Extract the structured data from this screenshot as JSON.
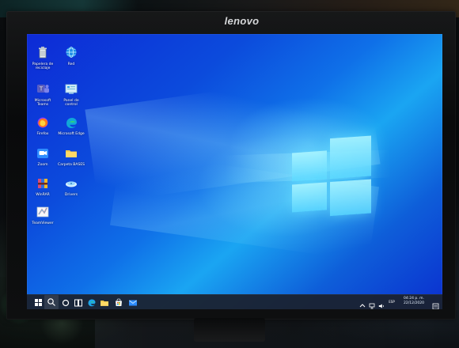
{
  "monitor": {
    "brand": "lenovo"
  },
  "desktop": {
    "icons": [
      {
        "label": "Papelera de reciclaje",
        "icon": "recycle-bin-icon"
      },
      {
        "label": "Red",
        "icon": "network-icon"
      },
      {
        "label": "Microsoft Teams",
        "icon": "teams-icon"
      },
      {
        "label": "Panel de control",
        "icon": "control-panel-icon"
      },
      {
        "label": "Firefox",
        "icon": "firefox-icon"
      },
      {
        "label": "Microsoft Edge",
        "icon": "edge-icon"
      },
      {
        "label": "Zoom",
        "icon": "zoom-icon"
      },
      {
        "label": "Carpeta BASES",
        "icon": "folder-icon"
      },
      {
        "label": "WinRAR",
        "icon": "winrar-icon"
      },
      {
        "label": "Drivers",
        "icon": "drivers-icon"
      },
      {
        "label": "TeamViewer",
        "icon": "teamviewer-icon"
      }
    ]
  },
  "taskbar": {
    "items": [
      {
        "name": "start",
        "icon": "windows-start-icon"
      },
      {
        "name": "search",
        "icon": "search-icon"
      },
      {
        "name": "cortana",
        "icon": "cortana-icon"
      },
      {
        "name": "task-view",
        "icon": "task-view-icon"
      },
      {
        "name": "edge",
        "icon": "edge-icon"
      },
      {
        "name": "file-explorer",
        "icon": "folder-icon"
      },
      {
        "name": "store",
        "icon": "store-icon"
      },
      {
        "name": "mail",
        "icon": "mail-icon"
      }
    ],
    "tray": {
      "time": "04:24 p. m.",
      "date": "22/12/2020",
      "lang": "ESP",
      "chevron": "^"
    }
  },
  "colors": {
    "screen_blue": "#0f70e8",
    "taskbar": "#1a2230",
    "logo_light": "#9eefff"
  }
}
